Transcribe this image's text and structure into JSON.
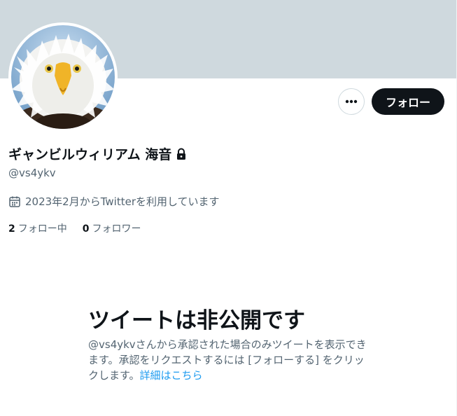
{
  "profile": {
    "display_name": "ギャンビルウィリアム 海音",
    "handle": "@vs4ykv",
    "joined": "2023年2月からTwitterを利用しています",
    "avatar_icon": "bald-eagle-avatar",
    "lock_icon": "lock-icon"
  },
  "actions": {
    "more_label": "…",
    "follow_label": "フォロー"
  },
  "stats": {
    "following_count": "2",
    "following_label": "フォロー中",
    "followers_count": "0",
    "followers_label": "フォロワー"
  },
  "private_notice": {
    "title": "ツイートは非公開です",
    "description": "@vs4ykvさんから承認された場合のみツイートを表示できます。承認をリクエストするには [フォローする] をクリックします。",
    "link_text": "詳細はこちら"
  },
  "colors": {
    "banner": "#cfd9de",
    "text_primary": "#0f1419",
    "text_secondary": "#536471",
    "link": "#1d9bf0",
    "follow_button": "#0f1419"
  }
}
